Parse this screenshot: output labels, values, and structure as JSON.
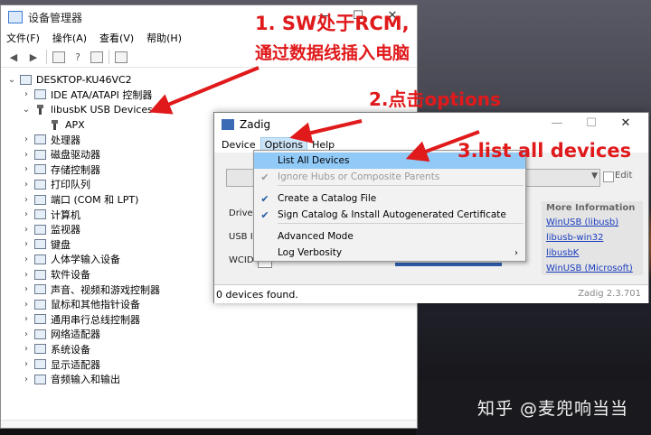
{
  "device_manager": {
    "title": "设备管理器",
    "window_controls": [
      "—",
      "☐",
      "✕"
    ],
    "menu": [
      "文件(F)",
      "操作(A)",
      "查看(V)",
      "帮助(H)"
    ],
    "tree": [
      {
        "label": "DESKTOP-KU46VC2",
        "level": 0,
        "expander": "⌄"
      },
      {
        "label": "IDE ATA/ATAPI 控制器",
        "level": 1,
        "expander": "›"
      },
      {
        "label": "libusbK USB Devices",
        "level": 1,
        "expander": "⌄"
      },
      {
        "label": "APX",
        "level": 2,
        "expander": ""
      },
      {
        "label": "处理器",
        "level": 1,
        "expander": "›"
      },
      {
        "label": "磁盘驱动器",
        "level": 1,
        "expander": "›"
      },
      {
        "label": "存储控制器",
        "level": 1,
        "expander": "›"
      },
      {
        "label": "打印队列",
        "level": 1,
        "expander": "›"
      },
      {
        "label": "端口 (COM 和 LPT)",
        "level": 1,
        "expander": "›"
      },
      {
        "label": "计算机",
        "level": 1,
        "expander": "›"
      },
      {
        "label": "监视器",
        "level": 1,
        "expander": "›"
      },
      {
        "label": "键盘",
        "level": 1,
        "expander": "›"
      },
      {
        "label": "人体学输入设备",
        "level": 1,
        "expander": "›"
      },
      {
        "label": "软件设备",
        "level": 1,
        "expander": "›"
      },
      {
        "label": "声音、视频和游戏控制器",
        "level": 1,
        "expander": "›"
      },
      {
        "label": "鼠标和其他指针设备",
        "level": 1,
        "expander": "›"
      },
      {
        "label": "通用串行总线控制器",
        "level": 1,
        "expander": "›"
      },
      {
        "label": "网络适配器",
        "level": 1,
        "expander": "›"
      },
      {
        "label": "系统设备",
        "level": 1,
        "expander": "›"
      },
      {
        "label": "显示适配器",
        "level": 1,
        "expander": "›"
      },
      {
        "label": "音频输入和输出",
        "level": 1,
        "expander": "›"
      }
    ]
  },
  "zadig": {
    "title": "Zadig",
    "window_controls": [
      "—",
      "☐",
      "✕"
    ],
    "menu": [
      "Device",
      "Options",
      "Help"
    ],
    "edit_label": "Edit",
    "labels": {
      "driver": "Driver",
      "usb_id": "USB ID",
      "wcid": "WCID"
    },
    "more_info": {
      "heading": "More Information",
      "links": [
        "WinUSB (libusb)",
        "libusb-win32",
        "libusbK",
        "WinUSB (Microsoft)"
      ]
    },
    "status": "0 devices found.",
    "version": "Zadig 2.3.701",
    "options_menu": [
      {
        "label": "List All Devices",
        "checked": false,
        "disabled": false,
        "highlighted": true
      },
      {
        "label": "Ignore Hubs or Composite Parents",
        "checked": true,
        "disabled": true,
        "highlighted": false
      },
      {
        "label": "Create a Catalog File",
        "checked": true,
        "disabled": false,
        "highlighted": false
      },
      {
        "label": "Sign Catalog & Install Autogenerated Certificate",
        "checked": true,
        "disabled": false,
        "highlighted": false
      },
      {
        "label": "Advanced Mode",
        "checked": false,
        "disabled": false,
        "highlighted": false
      },
      {
        "label": "Log Verbosity",
        "checked": false,
        "disabled": false,
        "highlighted": false,
        "submenu": true
      }
    ]
  },
  "annotations": {
    "step1_line1": "1.  SW处于RCM,",
    "step1_line2": "通过数据线插入电脑",
    "step2": "2.点击options",
    "step3": "3.list all devices",
    "color": "#e0191b"
  },
  "watermark": "知乎 @麦兜响当当"
}
